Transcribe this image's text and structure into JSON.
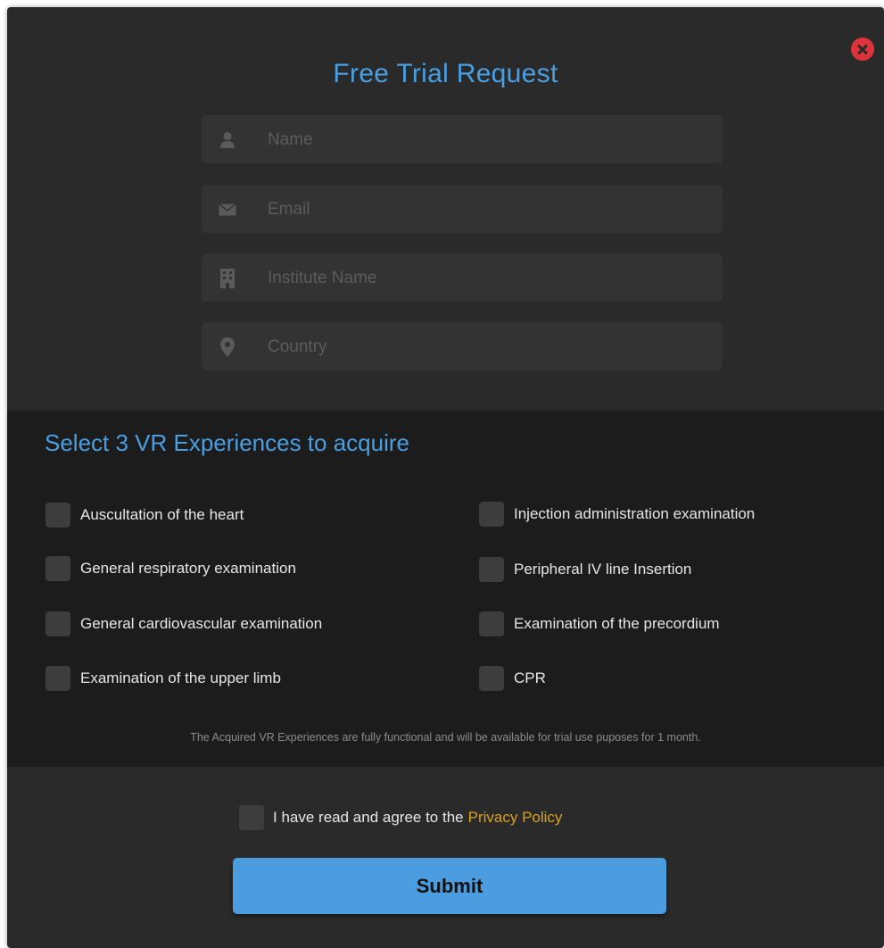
{
  "modal": {
    "title": "Free Trial Request"
  },
  "form": {
    "name": {
      "placeholder": "Name",
      "value": "",
      "icon": "user-icon"
    },
    "email": {
      "placeholder": "Email",
      "value": "",
      "icon": "envelope-icon"
    },
    "institute": {
      "placeholder": "Institute Name",
      "value": "",
      "icon": "building-icon"
    },
    "country": {
      "placeholder": "Country",
      "value": "",
      "icon": "map-pin-icon"
    }
  },
  "experiences": {
    "title": "Select 3 VR Experiences to acquire",
    "left": [
      {
        "label": "Auscultation of the heart",
        "checked": false
      },
      {
        "label": "General respiratory examination",
        "checked": false
      },
      {
        "label": "General cardiovascular examination",
        "checked": false
      },
      {
        "label": "Examination of the upper limb",
        "checked": false
      }
    ],
    "right": [
      {
        "label": "Injection administration examination",
        "checked": false
      },
      {
        "label": "Peripheral IV line Insertion",
        "checked": false
      },
      {
        "label": "Examination of the precordium",
        "checked": false
      },
      {
        "label": "CPR",
        "checked": false
      }
    ],
    "disclaimer": "The Acquired VR Experiences are fully functional and will be available for trial use puposes for 1 month."
  },
  "agreement": {
    "text": "I have read and agree to the",
    "link": "Privacy Policy",
    "checked": false
  },
  "submit_label": "Submit",
  "colors": {
    "accent": "#4a9fe3",
    "link": "#d9a21b",
    "close": "#e0323b",
    "background": "#2a2a2a",
    "section": "#1c1c1c"
  }
}
